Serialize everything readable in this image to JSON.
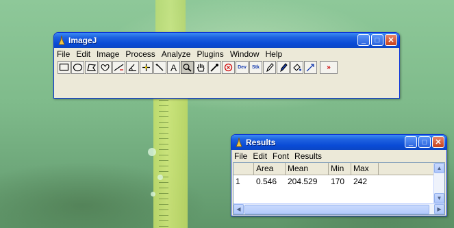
{
  "imagej": {
    "title": "ImageJ",
    "menu": [
      "File",
      "Edit",
      "Image",
      "Process",
      "Analyze",
      "Plugins",
      "Window",
      "Help"
    ],
    "tools": [
      {
        "name": "rectangle-tool-icon"
      },
      {
        "name": "oval-tool-icon"
      },
      {
        "name": "polygon-tool-icon"
      },
      {
        "name": "freehand-tool-icon"
      },
      {
        "name": "line-tool-icon"
      },
      {
        "name": "angle-tool-icon"
      },
      {
        "name": "point-tool-icon"
      },
      {
        "name": "wand-tool-icon"
      },
      {
        "name": "text-tool-icon",
        "label": "A"
      },
      {
        "name": "magnifier-tool-icon",
        "pressed": true
      },
      {
        "name": "hand-tool-icon"
      },
      {
        "name": "dropper-tool-icon"
      },
      {
        "name": "remove-overlay-icon"
      },
      {
        "name": "developer-menu-icon",
        "label": "Dev"
      },
      {
        "name": "stack-tools-icon",
        "label": "Stk"
      },
      {
        "name": "pencil-tool-icon"
      },
      {
        "name": "brush-tool-icon"
      },
      {
        "name": "flood-fill-tool-icon"
      },
      {
        "name": "arrow-tool-icon"
      }
    ],
    "more_tools_label": "»"
  },
  "results": {
    "title": "Results",
    "menu": [
      "File",
      "Edit",
      "Font",
      "Results"
    ],
    "columns": [
      "",
      "Area",
      "Mean",
      "Min",
      "Max"
    ],
    "rows": [
      [
        "1",
        "0.546",
        "204.529",
        "170",
        "242"
      ]
    ]
  },
  "colors": {
    "titlebar": "#0a4bd6",
    "window_bg": "#ece9d8",
    "close_button": "#c7411c",
    "accent_red": "#cc0000"
  }
}
